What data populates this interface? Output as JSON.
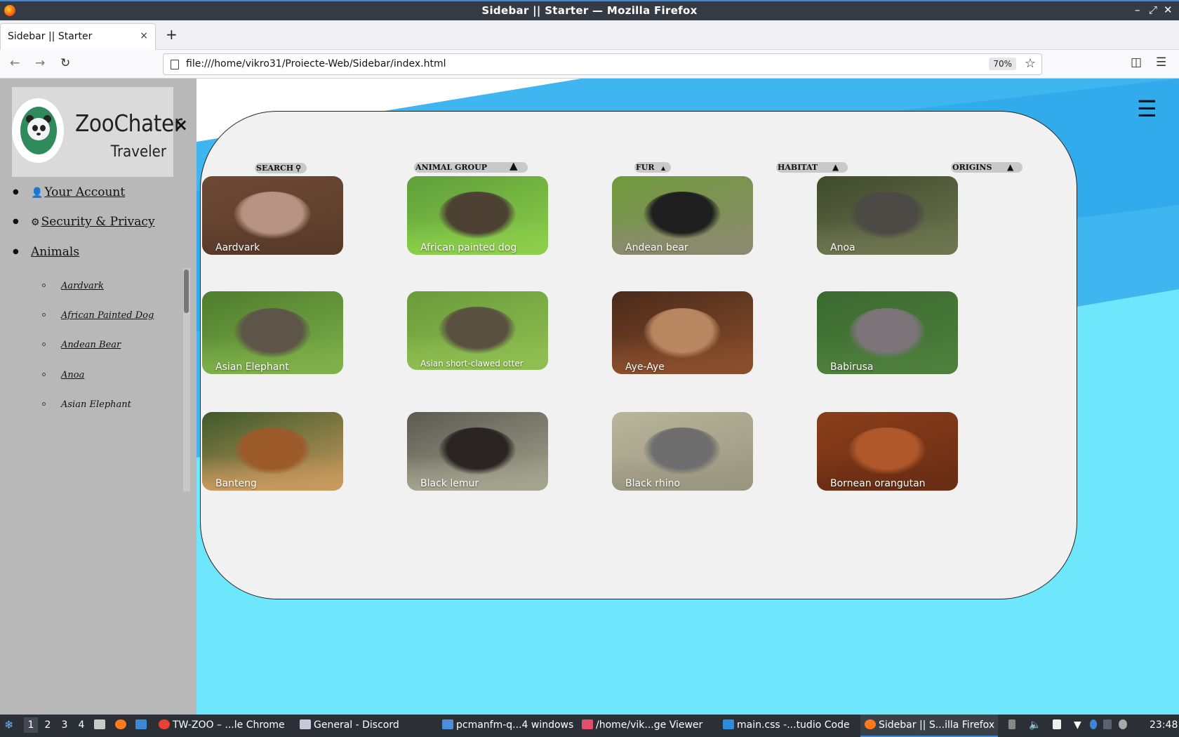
{
  "window": {
    "title": "Sidebar || Starter — Mozilla Firefox",
    "minimize": "–",
    "maximize": "⤢",
    "close": "✕"
  },
  "tabs": [
    {
      "label": "Sidebar || Starter",
      "close": "×"
    }
  ],
  "new_tab": "+",
  "nav": {
    "back": "←",
    "forward": "→",
    "reload": "↻",
    "url": "file:///home/vikro31/Proiecte-Web/Sidebar/index.html",
    "zoom": "70%",
    "bookmark": "☆",
    "pocket": "◫",
    "menu": "☰"
  },
  "sidebar": {
    "brand_title": "ZooChater",
    "brand_subtitle": "Traveler",
    "close": "×",
    "menu": [
      {
        "label": "Your Account",
        "icon": "user-icon",
        "glyph": "👤"
      },
      {
        "label": "Security & Privacy",
        "icon": "gear-icon",
        "glyph": "⚙"
      },
      {
        "label": "Animals"
      }
    ],
    "animals": [
      "Aardvark",
      "African Painted Dog",
      "Andean Bear",
      "Anoa",
      "Asian Elephant"
    ]
  },
  "hamburger": "☰",
  "filters": {
    "search": "SEARCH",
    "animal_group": "ANIMAL GROUP",
    "fur": "FUR",
    "habitat": "HABITAT",
    "origins": "ORIGINS"
  },
  "animals": [
    {
      "name": "Aardvark",
      "colors": [
        "#6e4a35",
        "#b79383",
        "#5a3b2a"
      ]
    },
    {
      "name": "African painted dog",
      "colors": [
        "#5f9e3a",
        "#4c4133",
        "#8ccf4a"
      ]
    },
    {
      "name": "Andean bear",
      "colors": [
        "#6f9a3c",
        "#1f1f1f",
        "#8c8a6e"
      ]
    },
    {
      "name": "Anoa",
      "colors": [
        "#3f4a2c",
        "#4c4a44",
        "#6e7550"
      ]
    },
    {
      "name": "Asian Elephant",
      "colors": [
        "#4e7d2d",
        "#5c5548",
        "#7fb04a"
      ]
    },
    {
      "name": "Asian short-clawed otter",
      "colors": [
        "#6b9b3a",
        "#5a5040",
        "#8fbf52"
      ]
    },
    {
      "name": "Aye-Aye",
      "colors": [
        "#4a2a1a",
        "#b88660",
        "#8a4e2c"
      ]
    },
    {
      "name": "Babirusa",
      "colors": [
        "#3a6a30",
        "#7c7478",
        "#4f7f3c"
      ]
    },
    {
      "name": "Banteng",
      "colors": [
        "#3e5a2a",
        "#9c5a2a",
        "#c9995e"
      ]
    },
    {
      "name": "Black lemur",
      "colors": [
        "#5a5a52",
        "#2a2522",
        "#a4a48f"
      ]
    },
    {
      "name": "Black rhino",
      "colors": [
        "#b9b59c",
        "#6e6e6e",
        "#9a9680"
      ]
    },
    {
      "name": "Bornean orangutan",
      "colors": [
        "#8a3e1a",
        "#b0582a",
        "#6a2e14"
      ]
    }
  ],
  "taskbar": {
    "workspaces": [
      "1",
      "2",
      "3",
      "4"
    ],
    "windows": [
      "TW-ZOO – ...le Chrome",
      "General - Discord",
      "pcmanfm-q...4 windows",
      "/home/vik...ge Viewer",
      "main.css -...tudio Code",
      "Sidebar || S...illa Firefox"
    ],
    "clock": "23:48"
  }
}
